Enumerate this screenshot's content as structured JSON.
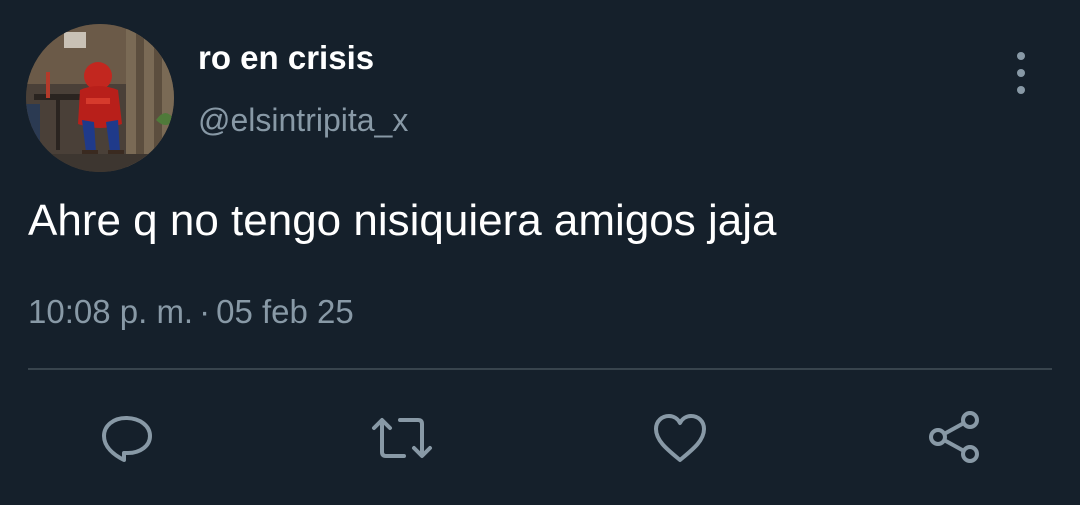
{
  "user": {
    "display_name": "ro en crisis",
    "handle": "@elsintripita_x"
  },
  "tweet": {
    "text": "Ahre q no tengo nisiquiera amigos jaja",
    "time": "10:08 p. m.",
    "separator": "·",
    "date": "05 feb 25"
  },
  "actions": {
    "reply_icon": "reply-icon",
    "retweet_icon": "retweet-icon",
    "like_icon": "heart-icon",
    "share_icon": "share-icon",
    "more_icon": "more-vertical-icon"
  },
  "colors": {
    "background": "#15202b",
    "primary_text": "#ffffff",
    "secondary_text": "#8899a6",
    "divider": "#38444d"
  }
}
